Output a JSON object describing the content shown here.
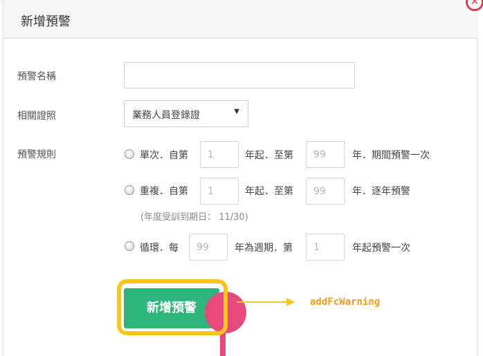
{
  "dialog": {
    "title": "新增預警",
    "close_glyph": "✕"
  },
  "form": {
    "name_label": "預警名稱",
    "name_value": "",
    "cert_label": "相關證照",
    "cert_selected": "業務人員登錄證",
    "rule_label": "預警規則"
  },
  "rules": {
    "single": {
      "t1": "單次．自第",
      "from": "1",
      "t2": "年起．至第",
      "to": "99",
      "t3": "年．期間預警一次"
    },
    "repeat": {
      "t1": "重複．自第",
      "from": "1",
      "t2": "年起．至第",
      "to": "99",
      "t3": "年．逐年預警",
      "hint": "(年度受訓到期日： 11/30)"
    },
    "cycle": {
      "t1": "循環．每",
      "every": "99",
      "t2": "年為週期．第",
      "start": "1",
      "t3": "年起預警一次"
    }
  },
  "submit_label": "新增預警",
  "annotation": "addFcWarning",
  "colors": {
    "primary_green": "#2db67c",
    "highlight_yellow": "#f7c51b",
    "pin_pink": "#e64a7d",
    "annotation_orange": "#f39b1a",
    "close_red": "#e23b50"
  }
}
